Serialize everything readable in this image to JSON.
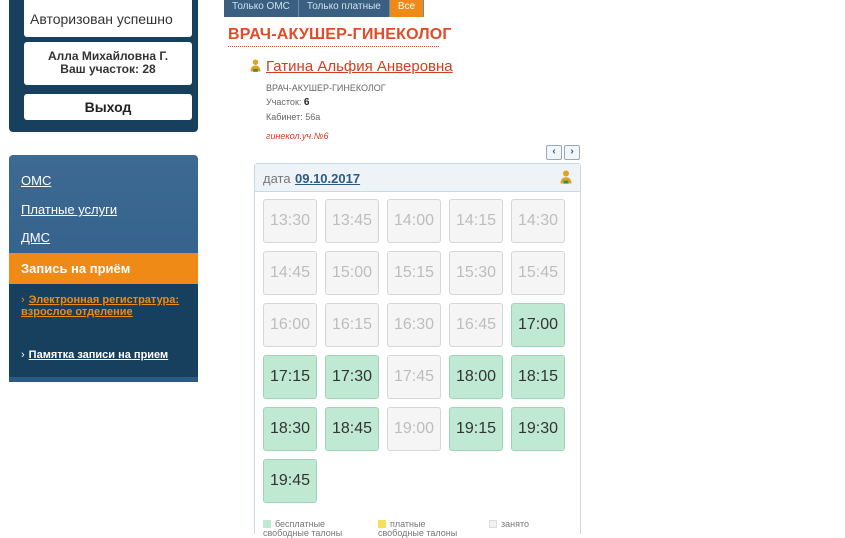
{
  "auth": {
    "status": "Авторизован успешно",
    "user_name": "Алла Михайловна Г.",
    "user_area": "Ваш участок: 28",
    "logout_label": "Выход"
  },
  "nav": {
    "items": [
      {
        "label": "ОМС"
      },
      {
        "label": "Платные услуги"
      },
      {
        "label": "ДМС"
      }
    ],
    "active_label": "Запись на приём",
    "sub_items": [
      {
        "label": "Электронная регистратура: взрослое отделение"
      },
      {
        "label": "Памятка записи на прием"
      }
    ]
  },
  "filters": {
    "tabs": [
      {
        "label": "Только ОМС"
      },
      {
        "label": "Только платные"
      },
      {
        "label": "Все"
      }
    ]
  },
  "doctor": {
    "specialty_title": "ВРАЧ-АКУШЕР-ГИНЕКОЛОГ",
    "name": "Гатина Альфия Анверовна",
    "position": "ВРАЧ-АКУШЕР-ГИНЕКОЛОГ",
    "area_label": "Участок:",
    "area_value": "6",
    "cabinet": "Кабинет: 56а",
    "note": "гинекол.уч.№6"
  },
  "schedule": {
    "date_label": "дата",
    "date_value": "09.10.2017",
    "prev_icon": "chevron-left-icon",
    "next_icon": "chevron-right-icon",
    "slots": [
      {
        "time": "13:30",
        "state": "busy"
      },
      {
        "time": "13:45",
        "state": "busy"
      },
      {
        "time": "14:00",
        "state": "busy"
      },
      {
        "time": "14:15",
        "state": "busy"
      },
      {
        "time": "14:30",
        "state": "busy"
      },
      {
        "time": "14:45",
        "state": "busy"
      },
      {
        "time": "15:00",
        "state": "busy"
      },
      {
        "time": "15:15",
        "state": "busy"
      },
      {
        "time": "15:30",
        "state": "busy"
      },
      {
        "time": "15:45",
        "state": "busy"
      },
      {
        "time": "16:00",
        "state": "busy"
      },
      {
        "time": "16:15",
        "state": "busy"
      },
      {
        "time": "16:30",
        "state": "busy"
      },
      {
        "time": "16:45",
        "state": "busy"
      },
      {
        "time": "17:00",
        "state": "free"
      },
      {
        "time": "17:15",
        "state": "free"
      },
      {
        "time": "17:30",
        "state": "free"
      },
      {
        "time": "17:45",
        "state": "busy"
      },
      {
        "time": "18:00",
        "state": "free"
      },
      {
        "time": "18:15",
        "state": "free"
      },
      {
        "time": "18:30",
        "state": "free"
      },
      {
        "time": "18:45",
        "state": "free"
      },
      {
        "time": "19:00",
        "state": "busy"
      },
      {
        "time": "19:15",
        "state": "free"
      },
      {
        "time": "19:30",
        "state": "free"
      },
      {
        "time": "19:45",
        "state": "free"
      }
    ],
    "legend": {
      "free_label": "бесплатные свободные талоны",
      "paid_label": "платные свободные талоны",
      "busy_label": "занято"
    }
  },
  "colors": {
    "accent": "#f08a17",
    "nav_dark": "#16405e",
    "free_slot": "#bfe9d2",
    "busy_slot": "#f5f5f5",
    "title_red": "#e24b26"
  }
}
